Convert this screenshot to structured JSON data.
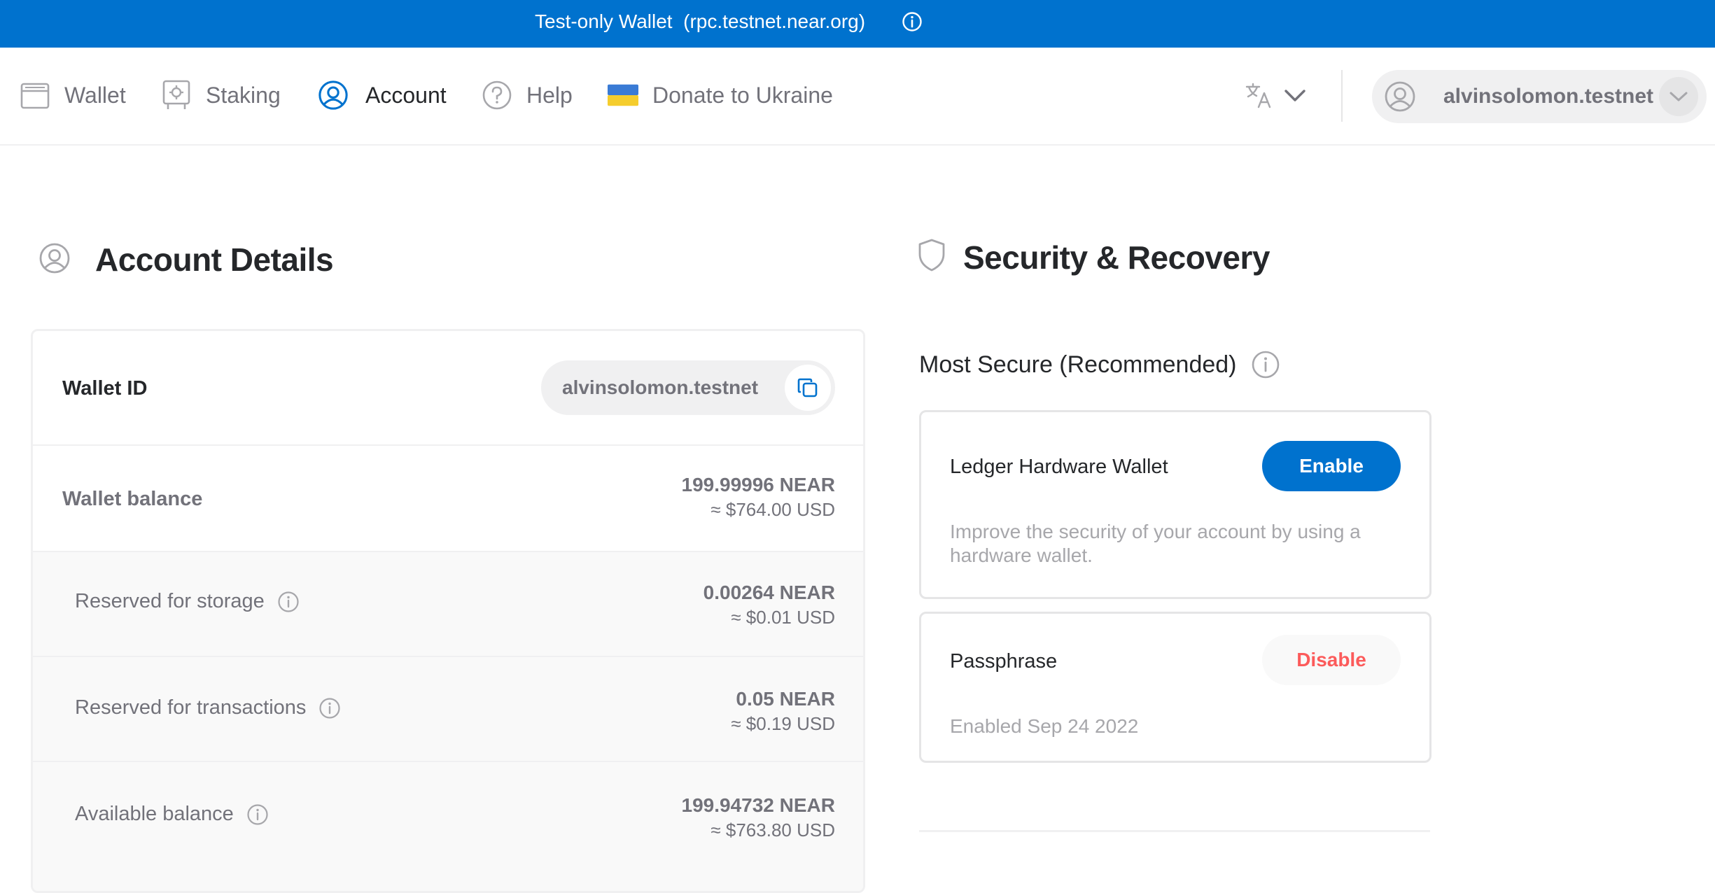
{
  "banner": {
    "text": "Test-only Wallet  (rpc.testnet.near.org)",
    "icon": "info-icon",
    "background": "#0072ce"
  },
  "nav": {
    "items": [
      {
        "label": "Wallet",
        "icon": "wallet-icon",
        "active": false
      },
      {
        "label": "Staking",
        "icon": "staking-icon",
        "active": false
      },
      {
        "label": "Account",
        "icon": "account-icon",
        "active": true
      },
      {
        "label": "Help",
        "icon": "help-icon",
        "active": false
      },
      {
        "label": "Donate to Ukraine",
        "icon": "ukraine-flag-icon",
        "active": false
      }
    ],
    "language_icon": "translate-icon",
    "account": {
      "name": "alvinsolomon.testnet",
      "icon": "user-avatar-icon"
    }
  },
  "account_details": {
    "title": "Account Details",
    "wallet_id": {
      "label": "Wallet ID",
      "value": "alvinsolomon.testnet"
    },
    "wallet_balance": {
      "label": "Wallet balance",
      "near": "199.99996 NEAR",
      "usd": "≈ $764.00 USD"
    },
    "breakdown": [
      {
        "label": "Reserved for storage",
        "near": "0.00264 NEAR",
        "usd": "≈ $0.01 USD"
      },
      {
        "label": "Reserved for transactions",
        "near": "0.05 NEAR",
        "usd": "≈ $0.19 USD"
      },
      {
        "label": "Available balance",
        "near": "199.94732 NEAR",
        "usd": "≈ $763.80 USD"
      }
    ]
  },
  "security": {
    "title": "Security & Recovery",
    "subtitle": "Most Secure (Recommended)",
    "options": [
      {
        "title": "Ledger Hardware Wallet",
        "button": "Enable",
        "description": "Improve the security of your account by using a hardware wallet."
      },
      {
        "title": "Passphrase",
        "button": "Disable",
        "description": "Enabled Sep 24 2022"
      }
    ]
  },
  "colors": {
    "accent": "#0072ce",
    "danger": "#fc5b5b",
    "muted": "#72727a"
  }
}
